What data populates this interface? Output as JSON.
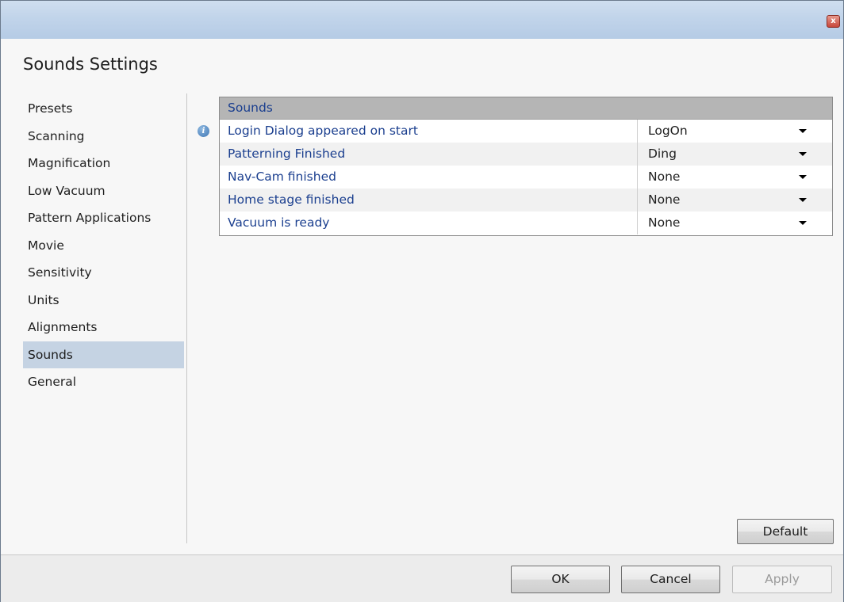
{
  "window": {
    "close_symbol": "x"
  },
  "dialog": {
    "title": "Sounds Settings"
  },
  "sidebar": {
    "items": [
      {
        "label": "Presets"
      },
      {
        "label": "Scanning"
      },
      {
        "label": "Magnification"
      },
      {
        "label": "Low Vacuum"
      },
      {
        "label": "Pattern Applications"
      },
      {
        "label": "Movie"
      },
      {
        "label": "Sensitivity"
      },
      {
        "label": "Units"
      },
      {
        "label": "Alignments"
      },
      {
        "label": "Sounds",
        "selected": true
      },
      {
        "label": "General"
      }
    ]
  },
  "grid": {
    "header": "Sounds",
    "info_symbol": "i",
    "rows": [
      {
        "label": "Login Dialog appeared on start",
        "value": "LogOn"
      },
      {
        "label": "Patterning Finished",
        "value": "Ding"
      },
      {
        "label": "Nav-Cam finished",
        "value": "None"
      },
      {
        "label": "Home stage finished",
        "value": "None"
      },
      {
        "label": "Vacuum is ready",
        "value": "None"
      }
    ]
  },
  "buttons": {
    "default": "Default",
    "ok": "OK",
    "cancel": "Cancel",
    "apply": "Apply",
    "apply_enabled": false
  },
  "colors": {
    "selected_nav": "#c5d3e3",
    "grid_header": "#b5b5b5",
    "label_text": "#1b3f8f"
  }
}
